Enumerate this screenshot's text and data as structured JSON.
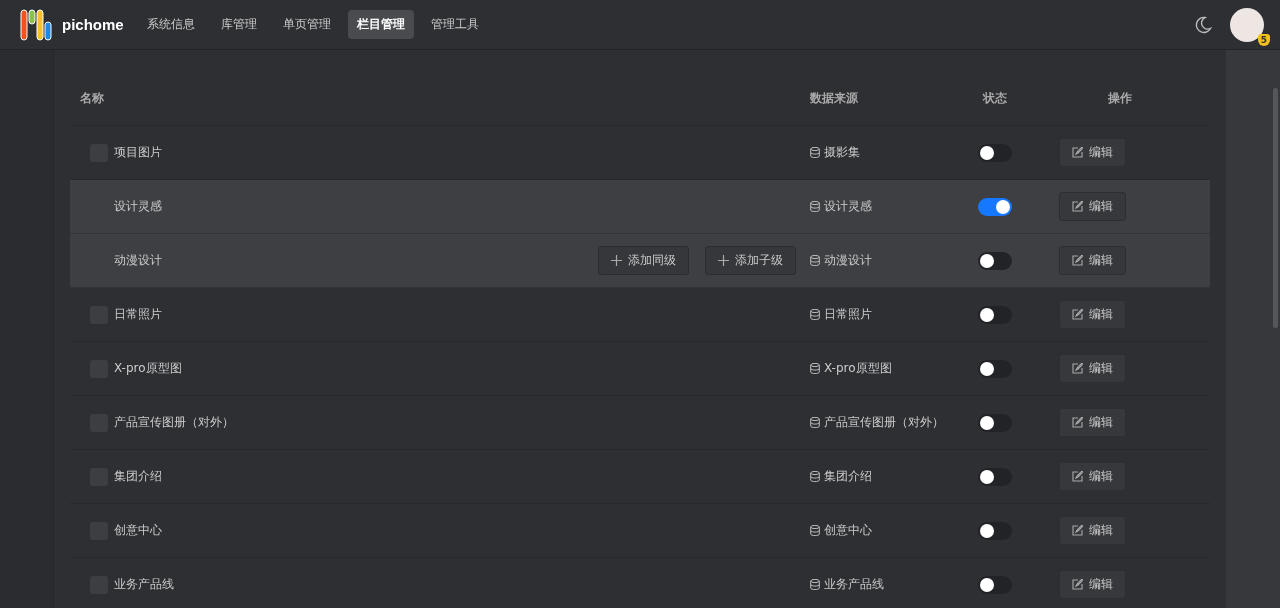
{
  "header": {
    "logo_text": "pichome",
    "nav": [
      {
        "label": "系统信息",
        "selected": false
      },
      {
        "label": "库管理",
        "selected": false
      },
      {
        "label": "单页管理",
        "selected": false
      },
      {
        "label": "栏目管理",
        "selected": true
      },
      {
        "label": "管理工具",
        "selected": false
      }
    ],
    "avatar_badge": "5"
  },
  "table": {
    "columns": [
      "名称",
      "数据来源",
      "状态",
      "操作"
    ],
    "rows": [
      {
        "name": "项目图片",
        "source": "摄影集",
        "on": false,
        "action": "编辑",
        "children": [
          {
            "name": "设计灵感",
            "source": "设计灵感",
            "on": true,
            "action": "编辑"
          },
          {
            "name": "动漫设计",
            "source": "动漫设计",
            "on": false,
            "action": "编辑",
            "row_buttons": [
              "添加同级",
              "添加子级"
            ]
          }
        ]
      },
      {
        "name": "日常照片",
        "source": "日常照片",
        "on": false,
        "action": "编辑"
      },
      {
        "name": "X-pro原型图",
        "source": "X-pro原型图",
        "on": false,
        "action": "编辑"
      },
      {
        "name": "产品宣传图册（对外）",
        "source": "产品宣传图册（对外）",
        "on": false,
        "action": "编辑"
      },
      {
        "name": "集团介绍",
        "source": "集团介绍",
        "on": false,
        "action": "编辑"
      },
      {
        "name": "创意中心",
        "source": "创意中心",
        "on": false,
        "action": "编辑"
      },
      {
        "name": "业务产品线",
        "source": "业务产品线",
        "on": false,
        "action": "编辑"
      }
    ]
  }
}
